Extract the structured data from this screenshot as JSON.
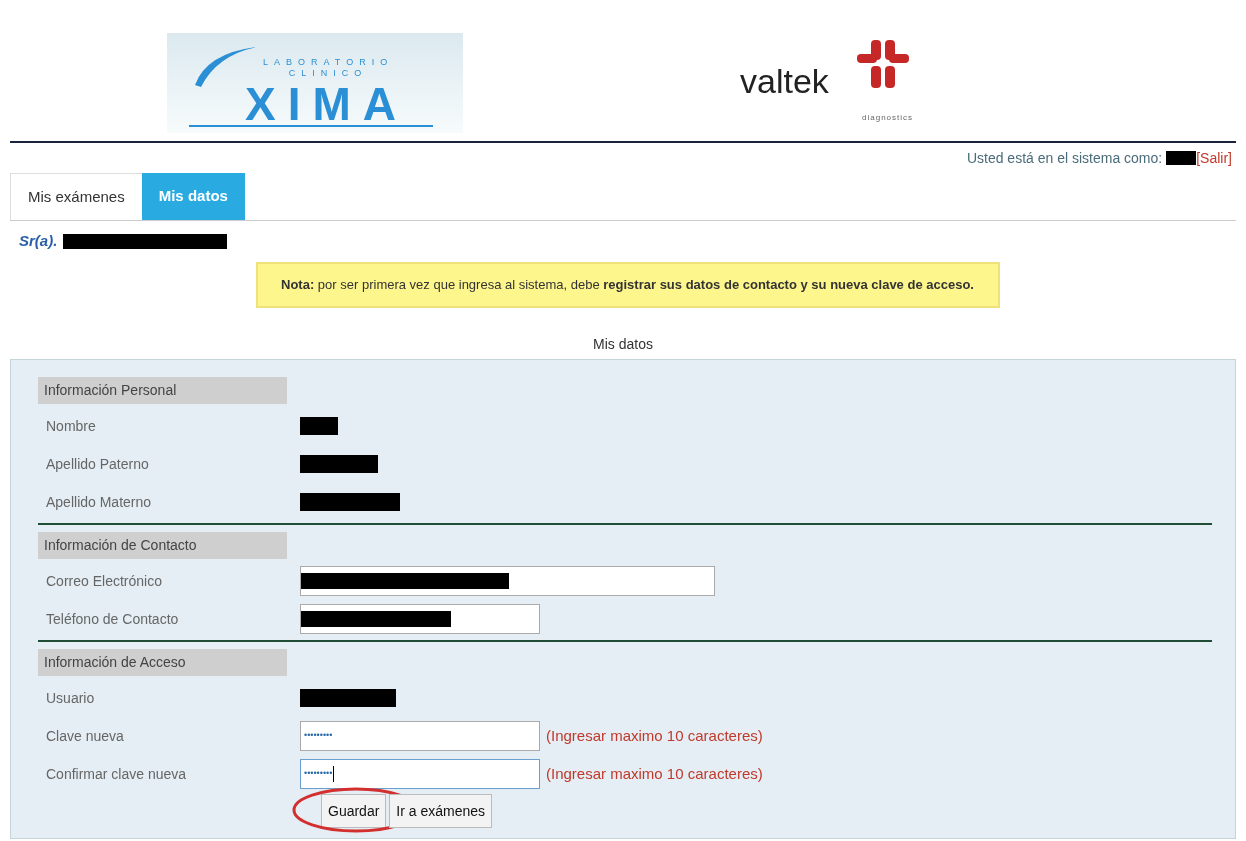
{
  "header": {
    "lab_logo": {
      "line_1": "LABORATORIO",
      "line_2": "CLINICO",
      "name": "XIMA"
    },
    "brand_logo": {
      "name": "valtek",
      "tagline": "diagnostics"
    }
  },
  "session": {
    "label": "Usted está en el sistema como:",
    "logout": "[Salir]"
  },
  "tabs": [
    {
      "label": "Mis exámenes",
      "selected": false
    },
    {
      "label": "Mis datos",
      "selected": true
    }
  ],
  "greeting": "Sr(a).",
  "note": "**Nota:** por ser primera vez que ingresa al sistema, debe **registrar sus datos de contacto y su nueva clave de acceso.**",
  "form_title": "Mis datos",
  "sections": [
    {
      "title": "Información Personal",
      "rows": [
        {
          "label": "Nombre",
          "kind": "redacted"
        },
        {
          "label": "Apellido Paterno",
          "kind": "redacted"
        },
        {
          "label": "Apellido Materno",
          "kind": "redacted"
        }
      ]
    },
    {
      "title": "Información de Contacto",
      "rows": [
        {
          "label": "Correo Electrónico",
          "kind": "redacted-field"
        },
        {
          "label": "Teléfono de Contacto",
          "kind": "redacted-field"
        }
      ]
    },
    {
      "title": "Información de Acceso",
      "rows": [
        {
          "label": "Usuario",
          "kind": "redacted"
        },
        {
          "label": "Clave nueva",
          "kind": "password",
          "value": "•••••••••",
          "hint": "(Ingresar maximo 10 caracteres)",
          "focused": false
        },
        {
          "label": "Confirmar clave nueva",
          "kind": "password",
          "value": "•••••••••",
          "hint": "(Ingresar maximo 10 caracteres)",
          "focused": true
        }
      ]
    }
  ],
  "buttons": [
    {
      "label": "Guardar",
      "circled": true
    },
    {
      "label": "Ir a exámenes",
      "circled": false
    }
  ]
}
